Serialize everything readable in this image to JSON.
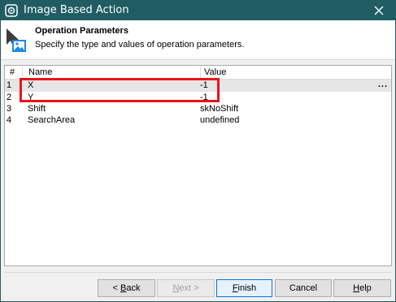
{
  "window": {
    "title": "Image Based Action"
  },
  "header": {
    "title": "Operation Parameters",
    "subtitle": "Specify the type and values of operation parameters."
  },
  "grid": {
    "columns": [
      "#",
      "Name",
      "Value"
    ],
    "rows": [
      {
        "index": "1",
        "name": "X",
        "value": "-1"
      },
      {
        "index": "2",
        "name": "Y",
        "value": "-1"
      },
      {
        "index": "3",
        "name": "Shift",
        "value": "skNoShift"
      },
      {
        "index": "4",
        "name": "SearchArea",
        "value": "undefined"
      }
    ],
    "edit_button": "..."
  },
  "buttons": {
    "back": {
      "prefix": "< ",
      "mnemonic": "B",
      "rest": "ack"
    },
    "next": {
      "prefix": "",
      "mnemonic": "N",
      "rest": "ext >"
    },
    "finish": {
      "prefix": "",
      "mnemonic": "F",
      "rest": "inish"
    },
    "cancel": "Cancel",
    "help": {
      "prefix": "",
      "mnemonic": "H",
      "rest": "elp"
    }
  },
  "colors": {
    "titlebar": "#1f5d63",
    "highlight": "#e8141c",
    "selected_row": "#e6e6e6"
  }
}
